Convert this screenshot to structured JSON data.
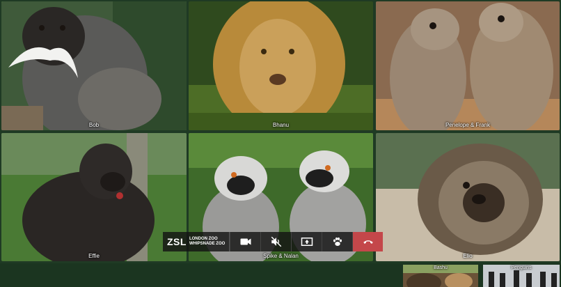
{
  "participants": [
    {
      "name": "Bob",
      "active": true
    },
    {
      "name": "Bhanu"
    },
    {
      "name": "Penelope & Frank"
    },
    {
      "name": "Effie"
    },
    {
      "name": "Spike & Nalan"
    },
    {
      "name": "Elio"
    }
  ],
  "thumbnails": [
    {
      "name": "Bashu"
    },
    {
      "name": "Penguins"
    }
  ],
  "controls": {
    "brand_short": "ZSL",
    "brand_line1": "LONDON ZOO",
    "brand_line2": "WHIPSNADE ZOO",
    "buttons": [
      {
        "icon": "video-camera-icon"
      },
      {
        "icon": "mute-icon"
      },
      {
        "icon": "share-screen-icon"
      },
      {
        "icon": "paw-icon"
      },
      {
        "icon": "end-call-icon"
      }
    ]
  },
  "colors": {
    "background": "#1f3a24",
    "active_border": "#7ed84f",
    "end_call": "#c4474a"
  }
}
